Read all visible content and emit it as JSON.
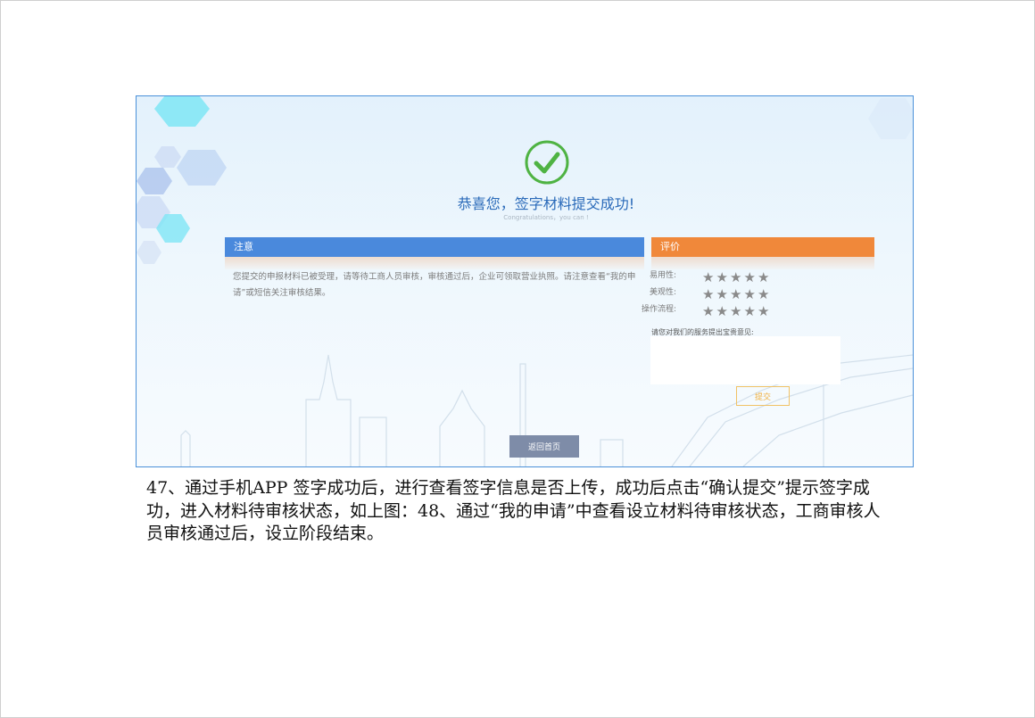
{
  "screenshot": {
    "success_title": "恭喜您，签字材料提交成功!",
    "success_subtitle": "Congratulations，you can !",
    "notice": {
      "header": "注意",
      "text": "您提交的申报材料已被受理，请等待工商人员审核，审核通过后，企业可领取营业执照。请注意查看“我的申请”或短信关注审核结果。"
    },
    "rating": {
      "header": "评价",
      "items": [
        {
          "label": "易用性:",
          "stars": 5
        },
        {
          "label": "美观性:",
          "stars": 5
        },
        {
          "label": "操作流程:",
          "stars": 5
        }
      ],
      "feedback_label": "请您对我们的服务提出宝贵意见:",
      "feedback_value": "",
      "submit_label": "提交"
    },
    "home_button_label": "返回首页"
  },
  "caption": "47、通过手机APP 签字成功后，进行查看签字信息是否上传，成功后点击“确认提交”提示签字成功，进入材料待审核状态，如上图：48、通过“我的申请”中查看设立材料待审核状态，工商审核人员审核通过后，设立阶段结束。",
  "colors": {
    "notice_header": "#4a89dc",
    "rating_header": "#f0883a",
    "success_green": "#4fb343",
    "title_blue": "#2a6ab9",
    "home_button": "#7e8ca8"
  },
  "icons": {
    "success": "check-circle-icon",
    "rating": "star-icon"
  }
}
